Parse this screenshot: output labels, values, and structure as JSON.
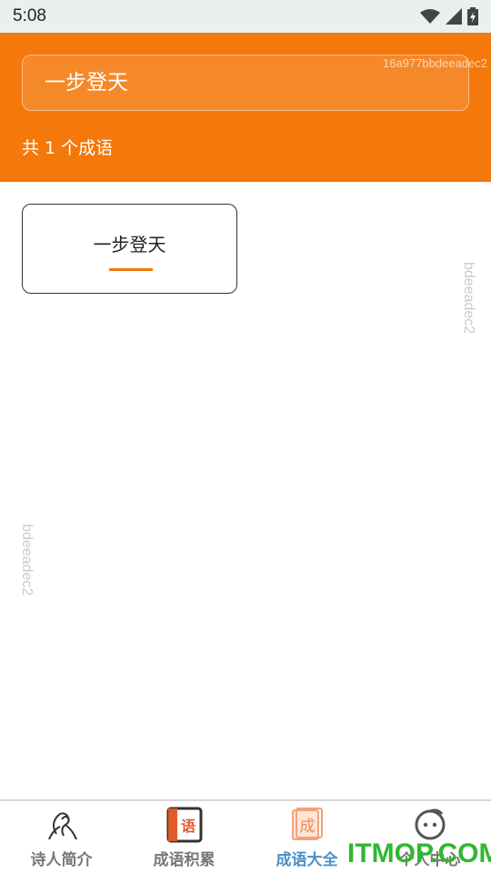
{
  "status_bar": {
    "time": "5:08"
  },
  "header": {
    "search_value": "一步登天",
    "watermark": "16a977bbdeeadec2",
    "count_text": "共 1 个成语"
  },
  "results": [
    {
      "text": "一步登天"
    }
  ],
  "watermarks": {
    "vertical_right": "bdeeadec2",
    "vertical_left": "bdeeadec2"
  },
  "bottom_nav": {
    "items": [
      {
        "label": "诗人简介",
        "icon": "poet-icon"
      },
      {
        "label": "成语积累",
        "icon": "book-icon",
        "icon_text": "语"
      },
      {
        "label": "成语大全",
        "icon": "idiom-book-icon",
        "icon_text": "成",
        "active": true
      },
      {
        "label": "个人中心",
        "icon": "face-icon"
      }
    ]
  },
  "brand_logo": "ITMOP.COM",
  "colors": {
    "accent": "#f4780c",
    "active_tab": "#4a90c8",
    "logo": "#2fb82f"
  }
}
